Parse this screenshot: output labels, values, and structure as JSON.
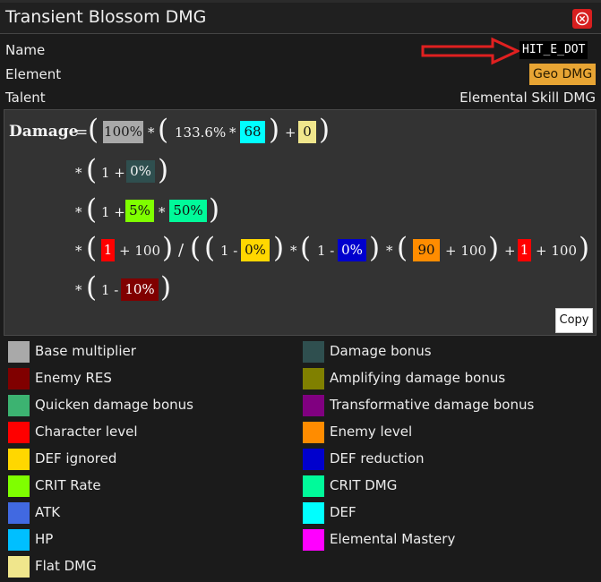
{
  "window": {
    "title": "Transient Blossom DMG"
  },
  "info": {
    "name_label": "Name",
    "name_value": "HIT_E_DOT",
    "element_label": "Element",
    "element_value": "Geo DMG",
    "talent_label": "Talent",
    "talent_value": "Elemental Skill DMG"
  },
  "formula": {
    "damage_label": "Damage",
    "eq": "=",
    "mul": "*",
    "plus": "+",
    "div": "/",
    "base_pct": "100%",
    "coef": "133.6%",
    "def": "68",
    "flat": "0",
    "one_plus": "1 +",
    "dmg_bonus": "0%",
    "crit_rate": "5%",
    "crit_dmg": "50%",
    "char_level": "1",
    "hundred": "100",
    "one_minus": "1 -",
    "def_ignored": "0%",
    "def_reduction": "0%",
    "enemy_level": "90",
    "char_level2": "1",
    "enemy_res": "10%"
  },
  "copy_label": "Copy",
  "legend": {
    "base_multiplier": "Base multiplier",
    "damage_bonus": "Damage bonus",
    "enemy_res": "Enemy RES",
    "amplifying": "Amplifying damage bonus",
    "quicken": "Quicken damage bonus",
    "transformative": "Transformative damage bonus",
    "character_level": "Character level",
    "enemy_level": "Enemy level",
    "def_ignored": "DEF ignored",
    "def_reduction": "DEF reduction",
    "crit_rate": "CRIT Rate",
    "crit_dmg": "CRIT DMG",
    "atk": "ATK",
    "def": "DEF",
    "hp": "HP",
    "elemental_mastery": "Elemental Mastery",
    "flat_dmg": "Flat DMG"
  },
  "colors": {
    "base": "#a9a9a9",
    "damage_bonus": "#2f4f4f",
    "enemy_res": "#800000",
    "amplifying": "#808000",
    "quicken": "#3cb371",
    "transformative": "#800080",
    "character_level": "#ff0000",
    "enemy_level": "#ff8c00",
    "def_ignored": "#ffd700",
    "def_reduction": "#0000cd",
    "crit_rate": "#7fff00",
    "crit_dmg": "#00fa9a",
    "atk": "#4169e1",
    "def": "#00ffff",
    "hp": "#00bfff",
    "elemental_mastery": "#ff00ff",
    "flat_dmg": "#f0e68c"
  }
}
